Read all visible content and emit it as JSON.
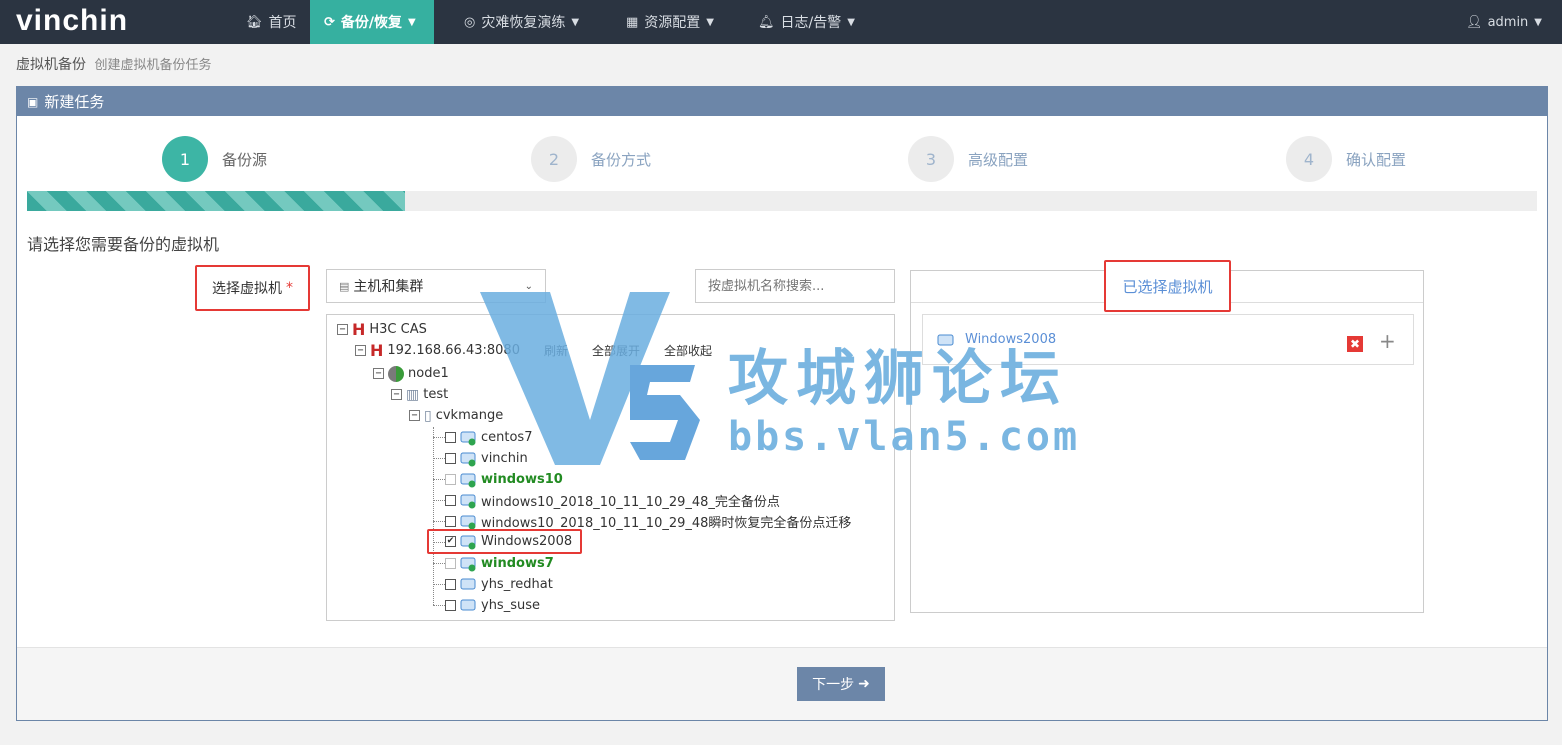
{
  "brand": "vinchin",
  "nav": [
    {
      "label": "首页",
      "icon": "home-icon"
    },
    {
      "label": "备份/恢复",
      "icon": "sync-icon",
      "active": true
    },
    {
      "label": "灾难恢复演练",
      "icon": "target-icon"
    },
    {
      "label": "资源配置",
      "icon": "grid-icon"
    },
    {
      "label": "日志/告警",
      "icon": "bell-icon"
    }
  ],
  "user": "admin",
  "breadcrumb": {
    "title": "虚拟机备份",
    "subtitle": "创建虚拟机备份任务"
  },
  "panel_title": "新建任务",
  "steps": [
    {
      "num": "1",
      "label": "备份源"
    },
    {
      "num": "2",
      "label": "备份方式"
    },
    {
      "num": "3",
      "label": "高级配置"
    },
    {
      "num": "4",
      "label": "确认配置"
    }
  ],
  "progress_fraction": 0.25,
  "prompt": "请选择您需要备份的虚拟机",
  "vm_label": "选择虚拟机",
  "required_mark": "*",
  "view_select": "主机和集群",
  "search_placeholder": "按虚拟机名称搜索...",
  "tree": {
    "root": "H3C CAS",
    "host": "192.168.66.43:8080",
    "actions": [
      "刷新",
      "全部展开",
      "全部收起"
    ],
    "node": "node1",
    "cluster": "test",
    "server": "cvkmange",
    "vms": [
      {
        "name": "centos7",
        "checked": false,
        "bold": false
      },
      {
        "name": "vinchin",
        "checked": false,
        "bold": false
      },
      {
        "name": "windows10",
        "checked": false,
        "bold": true
      },
      {
        "name": "windows10_2018_10_11_10_29_48_完全备份点",
        "checked": false,
        "bold": false
      },
      {
        "name": "windows10_2018_10_11_10_29_48瞬时恢复完全备份点迁移",
        "checked": false,
        "bold": false
      },
      {
        "name": "Windows2008",
        "checked": true,
        "bold": false
      },
      {
        "name": "windows7",
        "checked": false,
        "bold": true
      },
      {
        "name": "yhs_redhat",
        "checked": false,
        "bold": false
      },
      {
        "name": "yhs_suse",
        "checked": false,
        "bold": false
      }
    ]
  },
  "selected_title": "已选择虚拟机",
  "selected_vm": "Windows2008",
  "remove_symbol": "✖",
  "add_symbol": "+",
  "next_button": "下一步",
  "watermark": {
    "cn": "攻城狮论坛",
    "url": "bbs.vlan5.com"
  },
  "colors": {
    "topbar": "#2b3441",
    "accent": "#36b0a0",
    "panel": "#6c86a8",
    "highlight": "#e53935",
    "link": "#5b8fd6"
  }
}
